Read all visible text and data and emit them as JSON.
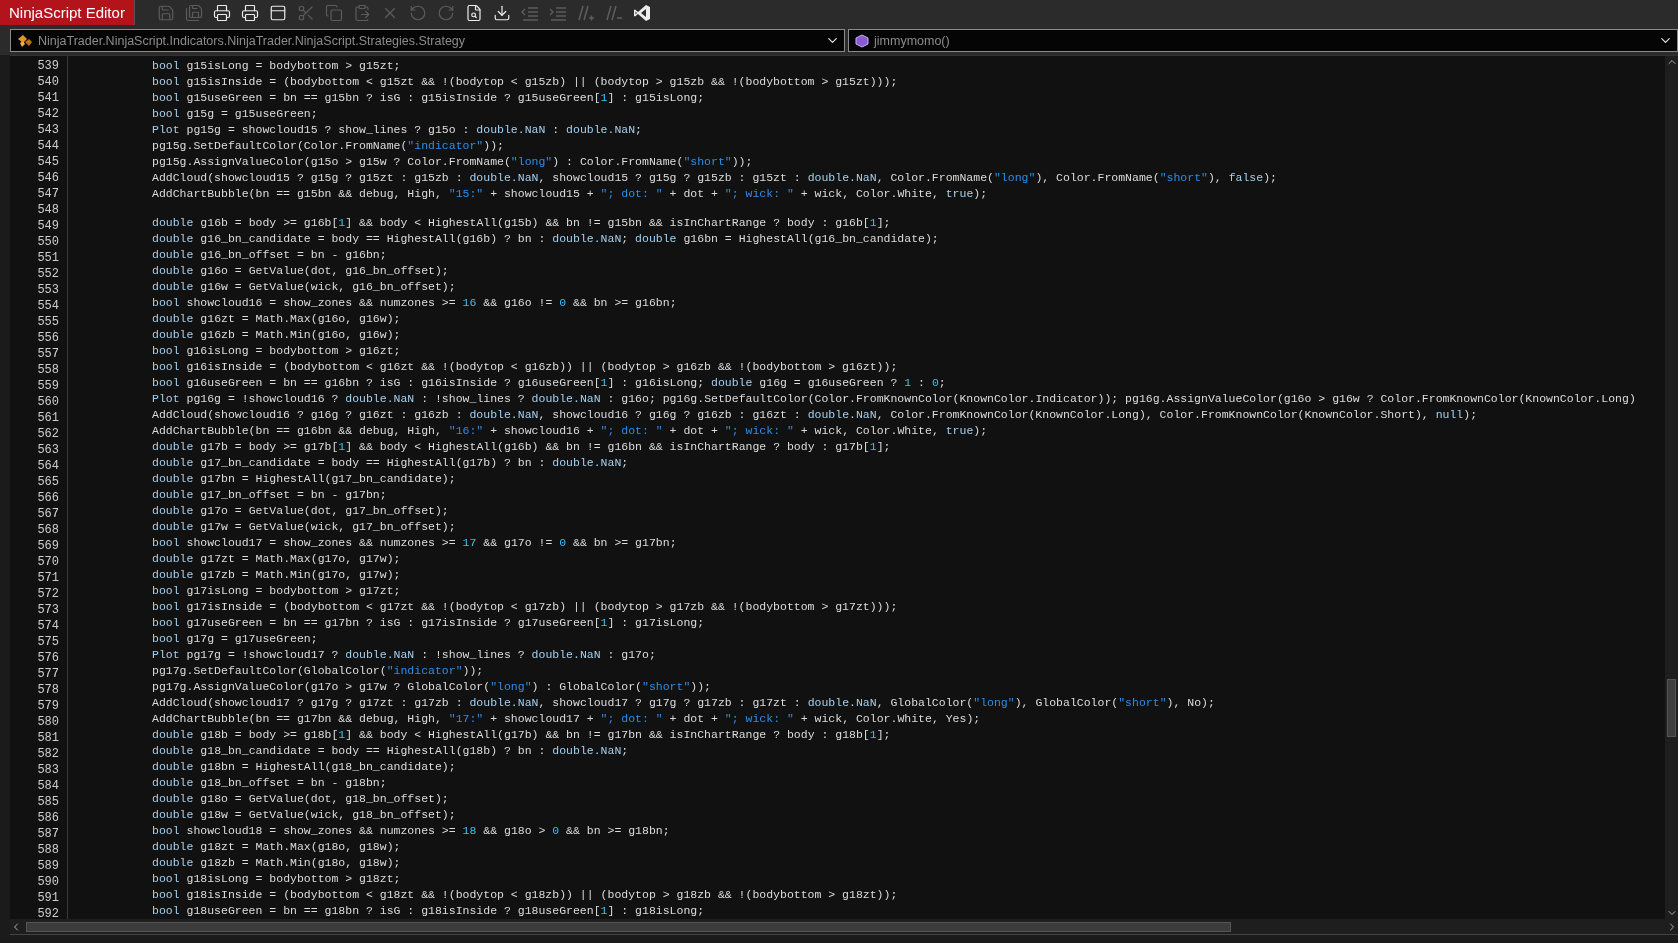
{
  "window": {
    "title": "NinjaScript Editor"
  },
  "toolbar": [
    {
      "kind": "save",
      "disabled": true
    },
    {
      "kind": "save-all",
      "disabled": true
    },
    {
      "kind": "print",
      "disabled": false
    },
    {
      "kind": "print-preview",
      "disabled": false
    },
    {
      "kind": "form",
      "disabled": false
    },
    {
      "kind": "cut",
      "disabled": true
    },
    {
      "kind": "copy",
      "disabled": true
    },
    {
      "kind": "paste",
      "disabled": true
    },
    {
      "kind": "delete",
      "disabled": true
    },
    {
      "kind": "undo",
      "disabled": true
    },
    {
      "kind": "redo",
      "disabled": true
    },
    {
      "kind": "find",
      "disabled": false
    },
    {
      "kind": "compile",
      "disabled": false
    },
    {
      "kind": "outdent",
      "disabled": true
    },
    {
      "kind": "indent",
      "disabled": true
    },
    {
      "kind": "comment",
      "disabled": true
    },
    {
      "kind": "uncomment",
      "disabled": true
    },
    {
      "kind": "visual-studio",
      "disabled": false
    }
  ],
  "type_selector": {
    "value": "NinjaTrader.NinjaScript.Indicators.NinjaTrader.NinjaScript.Strategies.Strategy"
  },
  "member_selector": {
    "value": "jimmymomo()"
  },
  "lines": [
    {
      "number": "539",
      "tokens": [
        {
          "kind": "keyword",
          "text": "bool"
        },
        {
          "kind": "plain",
          "text": " g15isLong = bodybottom > g15zt;"
        }
      ]
    },
    {
      "number": "540",
      "tokens": [
        {
          "kind": "keyword",
          "text": "bool"
        },
        {
          "kind": "plain",
          "text": " g15isInside = (bodybottom < g15zt && !(bodytop < g15zb) || (bodytop > g15zb && !(bodybottom > g15zt)));"
        }
      ]
    },
    {
      "number": "541",
      "tokens": [
        {
          "kind": "keyword",
          "text": "bool"
        },
        {
          "kind": "plain",
          "text": " g15useGreen = bn == g15bn ? isG : g15isInside ? g15useGreen["
        },
        {
          "kind": "number",
          "text": "1"
        },
        {
          "kind": "plain",
          "text": "] : g15isLong;"
        }
      ]
    },
    {
      "number": "542",
      "tokens": [
        {
          "kind": "keyword",
          "text": "bool"
        },
        {
          "kind": "plain",
          "text": " g15g = g15useGreen;"
        }
      ]
    },
    {
      "number": "543",
      "tokens": [
        {
          "kind": "keyword",
          "text": "Plot"
        },
        {
          "kind": "plain",
          "text": " pg15g = showcloud15 ? show_lines ? g15o : "
        },
        {
          "kind": "keyword",
          "text": "double.NaN"
        },
        {
          "kind": "plain",
          "text": " : "
        },
        {
          "kind": "keyword",
          "text": "double.NaN"
        },
        {
          "kind": "plain",
          "text": ";"
        }
      ]
    },
    {
      "number": "544",
      "tokens": [
        {
          "kind": "plain",
          "text": "pg15g.SetDefaultColor(Color.FromName("
        },
        {
          "kind": "string",
          "text": "\"indicator\""
        },
        {
          "kind": "plain",
          "text": "));"
        }
      ]
    },
    {
      "number": "545",
      "tokens": [
        {
          "kind": "plain",
          "text": "pg15g.AssignValueColor(g15o > g15w ? Color.FromName("
        },
        {
          "kind": "string",
          "text": "\"long\""
        },
        {
          "kind": "plain",
          "text": ") : Color.FromName("
        },
        {
          "kind": "string",
          "text": "\"short\""
        },
        {
          "kind": "plain",
          "text": "));"
        }
      ]
    },
    {
      "number": "546",
      "tokens": [
        {
          "kind": "plain",
          "text": "AddCloud(showcloud15 ? g15g ? g15zt : g15zb : "
        },
        {
          "kind": "keyword",
          "text": "double.NaN"
        },
        {
          "kind": "plain",
          "text": ", showcloud15 ? g15g ? g15zb : g15zt : "
        },
        {
          "kind": "keyword",
          "text": "double.NaN"
        },
        {
          "kind": "plain",
          "text": ", Color.FromName("
        },
        {
          "kind": "string",
          "text": "\"long\""
        },
        {
          "kind": "plain",
          "text": "), Color.FromName("
        },
        {
          "kind": "string",
          "text": "\"short\""
        },
        {
          "kind": "plain",
          "text": "), "
        },
        {
          "kind": "keyword",
          "text": "false"
        },
        {
          "kind": "plain",
          "text": ");"
        }
      ]
    },
    {
      "number": "547",
      "tokens": [
        {
          "kind": "plain",
          "text": "AddChartBubble(bn == g15bn && debug, High, "
        },
        {
          "kind": "string",
          "text": "\"15:\""
        },
        {
          "kind": "plain",
          "text": " + showcloud15 + "
        },
        {
          "kind": "string",
          "text": "\"; dot: \""
        },
        {
          "kind": "plain",
          "text": " + dot + "
        },
        {
          "kind": "string",
          "text": "\"; wick: \""
        },
        {
          "kind": "plain",
          "text": " + wick, Color.White, "
        },
        {
          "kind": "keyword",
          "text": "true"
        },
        {
          "kind": "plain",
          "text": ");"
        }
      ]
    },
    {
      "number": "548"
    },
    {
      "number": "549",
      "tokens": [
        {
          "kind": "keyword",
          "text": "double"
        },
        {
          "kind": "plain",
          "text": " g16b = body >= g16b["
        },
        {
          "kind": "number",
          "text": "1"
        },
        {
          "kind": "plain",
          "text": "] && body < HighestAll(g15b) && bn != g15bn && isInChartRange ? body : g16b["
        },
        {
          "kind": "number",
          "text": "1"
        },
        {
          "kind": "plain",
          "text": "];"
        }
      ]
    },
    {
      "number": "550",
      "tokens": [
        {
          "kind": "keyword",
          "text": "double"
        },
        {
          "kind": "plain",
          "text": " g16_bn_candidate = body == HighestAll(g16b) ? bn : "
        },
        {
          "kind": "keyword",
          "text": "double.NaN"
        },
        {
          "kind": "plain",
          "text": "; "
        },
        {
          "kind": "keyword",
          "text": "double"
        },
        {
          "kind": "plain",
          "text": " g16bn = HighestAll(g16_bn_candidate);"
        }
      ]
    },
    {
      "number": "551",
      "tokens": [
        {
          "kind": "keyword",
          "text": "double"
        },
        {
          "kind": "plain",
          "text": " g16_bn_offset = bn - g16bn;"
        }
      ]
    },
    {
      "number": "552",
      "tokens": [
        {
          "kind": "keyword",
          "text": "double"
        },
        {
          "kind": "plain",
          "text": " g16o = GetValue(dot, g16_bn_offset);"
        }
      ]
    },
    {
      "number": "553",
      "tokens": [
        {
          "kind": "keyword",
          "text": "double"
        },
        {
          "kind": "plain",
          "text": " g16w = GetValue(wick, g16_bn_offset);"
        }
      ]
    },
    {
      "number": "554",
      "tokens": [
        {
          "kind": "keyword",
          "text": "bool"
        },
        {
          "kind": "plain",
          "text": " showcloud16 = show_zones && numzones >= "
        },
        {
          "kind": "number",
          "text": "16"
        },
        {
          "kind": "plain",
          "text": " && g16o != "
        },
        {
          "kind": "number",
          "text": "0"
        },
        {
          "kind": "plain",
          "text": " && bn >= g16bn;"
        }
      ]
    },
    {
      "number": "555",
      "tokens": [
        {
          "kind": "keyword",
          "text": "double"
        },
        {
          "kind": "plain",
          "text": " g16zt = Math.Max(g16o, g16w);"
        }
      ]
    },
    {
      "number": "556",
      "tokens": [
        {
          "kind": "keyword",
          "text": "double"
        },
        {
          "kind": "plain",
          "text": " g16zb = Math.Min(g16o, g16w);"
        }
      ]
    },
    {
      "number": "557",
      "tokens": [
        {
          "kind": "keyword",
          "text": "bool"
        },
        {
          "kind": "plain",
          "text": " g16isLong = bodybottom > g16zt;"
        }
      ]
    },
    {
      "number": "558",
      "tokens": [
        {
          "kind": "keyword",
          "text": "bool"
        },
        {
          "kind": "plain",
          "text": " g16isInside = (bodybottom < g16zt && !(bodytop < g16zb)) || (bodytop > g16zb && !(bodybottom > g16zt));"
        }
      ]
    },
    {
      "number": "559",
      "tokens": [
        {
          "kind": "keyword",
          "text": "bool"
        },
        {
          "kind": "plain",
          "text": " g16useGreen = bn == g16bn ? isG : g16isInside ? g16useGreen["
        },
        {
          "kind": "number",
          "text": "1"
        },
        {
          "kind": "plain",
          "text": "] : g16isLong; "
        },
        {
          "kind": "keyword",
          "text": "double"
        },
        {
          "kind": "plain",
          "text": " g16g = g16useGreen ? "
        },
        {
          "kind": "number",
          "text": "1"
        },
        {
          "kind": "plain",
          "text": " : "
        },
        {
          "kind": "number",
          "text": "0"
        },
        {
          "kind": "plain",
          "text": ";"
        }
      ]
    },
    {
      "number": "560",
      "tokens": [
        {
          "kind": "keyword",
          "text": "Plot"
        },
        {
          "kind": "plain",
          "text": " pg16g = !showcloud16 ? "
        },
        {
          "kind": "keyword",
          "text": "double.NaN"
        },
        {
          "kind": "plain",
          "text": " : !show_lines ? "
        },
        {
          "kind": "keyword",
          "text": "double.NaN"
        },
        {
          "kind": "plain",
          "text": " : g16o; pg16g.SetDefaultColor(Color.FromKnownColor(KnownColor.Indicator)); pg16g.AssignValueColor(g16o > g16w ? Color.FromKnownColor(KnownColor.Long)"
        }
      ]
    },
    {
      "number": "561",
      "tokens": [
        {
          "kind": "plain",
          "text": "AddCloud(showcloud16 ? g16g ? g16zt : g16zb : "
        },
        {
          "kind": "keyword",
          "text": "double.NaN"
        },
        {
          "kind": "plain",
          "text": ", showcloud16 ? g16g ? g16zb : g16zt : "
        },
        {
          "kind": "keyword",
          "text": "double.NaN"
        },
        {
          "kind": "plain",
          "text": ", Color.FromKnownColor(KnownColor.Long), Color.FromKnownColor(KnownColor.Short), "
        },
        {
          "kind": "keyword",
          "text": "null"
        },
        {
          "kind": "plain",
          "text": ");"
        }
      ]
    },
    {
      "number": "562",
      "tokens": [
        {
          "kind": "plain",
          "text": "AddChartBubble(bn == g16bn && debug, High, "
        },
        {
          "kind": "string",
          "text": "\"16:\""
        },
        {
          "kind": "plain",
          "text": " + showcloud16 + "
        },
        {
          "kind": "string",
          "text": "\"; dot: \""
        },
        {
          "kind": "plain",
          "text": " + dot + "
        },
        {
          "kind": "string",
          "text": "\"; wick: \""
        },
        {
          "kind": "plain",
          "text": " + wick, Color.White, "
        },
        {
          "kind": "keyword",
          "text": "true"
        },
        {
          "kind": "plain",
          "text": ");"
        }
      ]
    },
    {
      "number": "563",
      "tokens": [
        {
          "kind": "keyword",
          "text": "double"
        },
        {
          "kind": "plain",
          "text": " g17b = body >= g17b["
        },
        {
          "kind": "number",
          "text": "1"
        },
        {
          "kind": "plain",
          "text": "] && body < HighestAll(g16b) && bn != g16bn && isInChartRange ? body : g17b["
        },
        {
          "kind": "number",
          "text": "1"
        },
        {
          "kind": "plain",
          "text": "];"
        }
      ]
    },
    {
      "number": "564",
      "tokens": [
        {
          "kind": "keyword",
          "text": "double"
        },
        {
          "kind": "plain",
          "text": " g17_bn_candidate = body == HighestAll(g17b) ? bn : "
        },
        {
          "kind": "keyword",
          "text": "double.NaN"
        },
        {
          "kind": "plain",
          "text": ";"
        }
      ]
    },
    {
      "number": "565",
      "tokens": [
        {
          "kind": "keyword",
          "text": "double"
        },
        {
          "kind": "plain",
          "text": " g17bn = HighestAll(g17_bn_candidate);"
        }
      ]
    },
    {
      "number": "566",
      "tokens": [
        {
          "kind": "keyword",
          "text": "double"
        },
        {
          "kind": "plain",
          "text": " g17_bn_offset = bn - g17bn;"
        }
      ]
    },
    {
      "number": "567",
      "tokens": [
        {
          "kind": "keyword",
          "text": "double"
        },
        {
          "kind": "plain",
          "text": " g17o = GetValue(dot, g17_bn_offset);"
        }
      ]
    },
    {
      "number": "568",
      "tokens": [
        {
          "kind": "keyword",
          "text": "double"
        },
        {
          "kind": "plain",
          "text": " g17w = GetValue(wick, g17_bn_offset);"
        }
      ]
    },
    {
      "number": "569",
      "tokens": [
        {
          "kind": "keyword",
          "text": "bool"
        },
        {
          "kind": "plain",
          "text": " showcloud17 = show_zones && numzones >= "
        },
        {
          "kind": "number",
          "text": "17"
        },
        {
          "kind": "plain",
          "text": " && g17o != "
        },
        {
          "kind": "number",
          "text": "0"
        },
        {
          "kind": "plain",
          "text": " && bn >= g17bn;"
        }
      ]
    },
    {
      "number": "570",
      "tokens": [
        {
          "kind": "keyword",
          "text": "double"
        },
        {
          "kind": "plain",
          "text": " g17zt = Math.Max(g17o, g17w);"
        }
      ]
    },
    {
      "number": "571",
      "tokens": [
        {
          "kind": "keyword",
          "text": "double"
        },
        {
          "kind": "plain",
          "text": " g17zb = Math.Min(g17o, g17w);"
        }
      ]
    },
    {
      "number": "572",
      "tokens": [
        {
          "kind": "keyword",
          "text": "bool"
        },
        {
          "kind": "plain",
          "text": " g17isLong = bodybottom > g17zt;"
        }
      ]
    },
    {
      "number": "573",
      "tokens": [
        {
          "kind": "keyword",
          "text": "bool"
        },
        {
          "kind": "plain",
          "text": " g17isInside = (bodybottom < g17zt && !(bodytop < g17zb) || (bodytop > g17zb && !(bodybottom > g17zt)));"
        }
      ]
    },
    {
      "number": "574",
      "tokens": [
        {
          "kind": "keyword",
          "text": "bool"
        },
        {
          "kind": "plain",
          "text": " g17useGreen = bn == g17bn ? isG : g17isInside ? g17useGreen["
        },
        {
          "kind": "number",
          "text": "1"
        },
        {
          "kind": "plain",
          "text": "] : g17isLong;"
        }
      ]
    },
    {
      "number": "575",
      "tokens": [
        {
          "kind": "keyword",
          "text": "bool"
        },
        {
          "kind": "plain",
          "text": " g17g = g17useGreen;"
        }
      ]
    },
    {
      "number": "576",
      "tokens": [
        {
          "kind": "keyword",
          "text": "Plot"
        },
        {
          "kind": "plain",
          "text": " pg17g = !showcloud17 ? "
        },
        {
          "kind": "keyword",
          "text": "double.NaN"
        },
        {
          "kind": "plain",
          "text": " : !show_lines ? "
        },
        {
          "kind": "keyword",
          "text": "double.NaN"
        },
        {
          "kind": "plain",
          "text": " : g17o;"
        }
      ]
    },
    {
      "number": "577",
      "tokens": [
        {
          "kind": "plain",
          "text": "pg17g.SetDefaultColor(GlobalColor("
        },
        {
          "kind": "string",
          "text": "\"indicator\""
        },
        {
          "kind": "plain",
          "text": "));"
        }
      ]
    },
    {
      "number": "578",
      "tokens": [
        {
          "kind": "plain",
          "text": "pg17g.AssignValueColor(g17o > g17w ? GlobalColor("
        },
        {
          "kind": "string",
          "text": "\"long\""
        },
        {
          "kind": "plain",
          "text": ") : GlobalColor("
        },
        {
          "kind": "string",
          "text": "\"short\""
        },
        {
          "kind": "plain",
          "text": "));"
        }
      ]
    },
    {
      "number": "579",
      "tokens": [
        {
          "kind": "plain",
          "text": "AddCloud(showcloud17 ? g17g ? g17zt : g17zb : "
        },
        {
          "kind": "keyword",
          "text": "double.NaN"
        },
        {
          "kind": "plain",
          "text": ", showcloud17 ? g17g ? g17zb : g17zt : "
        },
        {
          "kind": "keyword",
          "text": "double.NaN"
        },
        {
          "kind": "plain",
          "text": ", GlobalColor("
        },
        {
          "kind": "string",
          "text": "\"long\""
        },
        {
          "kind": "plain",
          "text": "), GlobalColor("
        },
        {
          "kind": "string",
          "text": "\"short\""
        },
        {
          "kind": "plain",
          "text": "), No);"
        }
      ]
    },
    {
      "number": "580",
      "tokens": [
        {
          "kind": "plain",
          "text": "AddChartBubble(bn == g17bn && debug, High, "
        },
        {
          "kind": "string",
          "text": "\"17:\""
        },
        {
          "kind": "plain",
          "text": " + showcloud17 + "
        },
        {
          "kind": "string",
          "text": "\"; dot: \""
        },
        {
          "kind": "plain",
          "text": " + dot + "
        },
        {
          "kind": "string",
          "text": "\"; wick: \""
        },
        {
          "kind": "plain",
          "text": " + wick, Color.White, Yes);"
        }
      ]
    },
    {
      "number": "581",
      "tokens": [
        {
          "kind": "keyword",
          "text": "double"
        },
        {
          "kind": "plain",
          "text": " g18b = body >= g18b["
        },
        {
          "kind": "number",
          "text": "1"
        },
        {
          "kind": "plain",
          "text": "] && body < HighestAll(g17b) && bn != g17bn && isInChartRange ? body : g18b["
        },
        {
          "kind": "number",
          "text": "1"
        },
        {
          "kind": "plain",
          "text": "];"
        }
      ]
    },
    {
      "number": "582",
      "tokens": [
        {
          "kind": "keyword",
          "text": "double"
        },
        {
          "kind": "plain",
          "text": " g18_bn_candidate = body == HighestAll(g18b) ? bn : "
        },
        {
          "kind": "keyword",
          "text": "double.NaN"
        },
        {
          "kind": "plain",
          "text": ";"
        }
      ]
    },
    {
      "number": "583",
      "tokens": [
        {
          "kind": "keyword",
          "text": "double"
        },
        {
          "kind": "plain",
          "text": " g18bn = HighestAll(g18_bn_candidate);"
        }
      ]
    },
    {
      "number": "584",
      "tokens": [
        {
          "kind": "keyword",
          "text": "double"
        },
        {
          "kind": "plain",
          "text": " g18_bn_offset = bn - g18bn;"
        }
      ]
    },
    {
      "number": "585",
      "tokens": [
        {
          "kind": "keyword",
          "text": "double"
        },
        {
          "kind": "plain",
          "text": " g18o = GetValue(dot, g18_bn_offset);"
        }
      ]
    },
    {
      "number": "586",
      "tokens": [
        {
          "kind": "keyword",
          "text": "double"
        },
        {
          "kind": "plain",
          "text": " g18w = GetValue(wick, g18_bn_offset);"
        }
      ]
    },
    {
      "number": "587",
      "tokens": [
        {
          "kind": "keyword",
          "text": "bool"
        },
        {
          "kind": "plain",
          "text": " showcloud18 = show_zones && numzones >= "
        },
        {
          "kind": "number",
          "text": "18"
        },
        {
          "kind": "plain",
          "text": " && g18o > "
        },
        {
          "kind": "number",
          "text": "0"
        },
        {
          "kind": "plain",
          "text": " && bn >= g18bn;"
        }
      ]
    },
    {
      "number": "588",
      "tokens": [
        {
          "kind": "keyword",
          "text": "double"
        },
        {
          "kind": "plain",
          "text": " g18zt = Math.Max(g18o, g18w);"
        }
      ]
    },
    {
      "number": "589",
      "tokens": [
        {
          "kind": "keyword",
          "text": "double"
        },
        {
          "kind": "plain",
          "text": " g18zb = Math.Min(g18o, g18w);"
        }
      ]
    },
    {
      "number": "590",
      "tokens": [
        {
          "kind": "keyword",
          "text": "bool"
        },
        {
          "kind": "plain",
          "text": " g18isLong = bodybottom > g18zt;"
        }
      ]
    },
    {
      "number": "591",
      "tokens": [
        {
          "kind": "keyword",
          "text": "bool"
        },
        {
          "kind": "plain",
          "text": " g18isInside = (bodybottom < g18zt && !(bodytop < g18zb)) || (bodytop > g18zb && !(bodybottom > g18zt));"
        }
      ]
    },
    {
      "number": "592",
      "tokens": [
        {
          "kind": "keyword",
          "text": "bool"
        },
        {
          "kind": "plain",
          "text": " g18useGreen = bn == g18bn ? isG : g18isInside ? g18useGreen["
        },
        {
          "kind": "number",
          "text": "1"
        },
        {
          "kind": "plain",
          "text": "] : g18isLong;"
        }
      ]
    }
  ]
}
